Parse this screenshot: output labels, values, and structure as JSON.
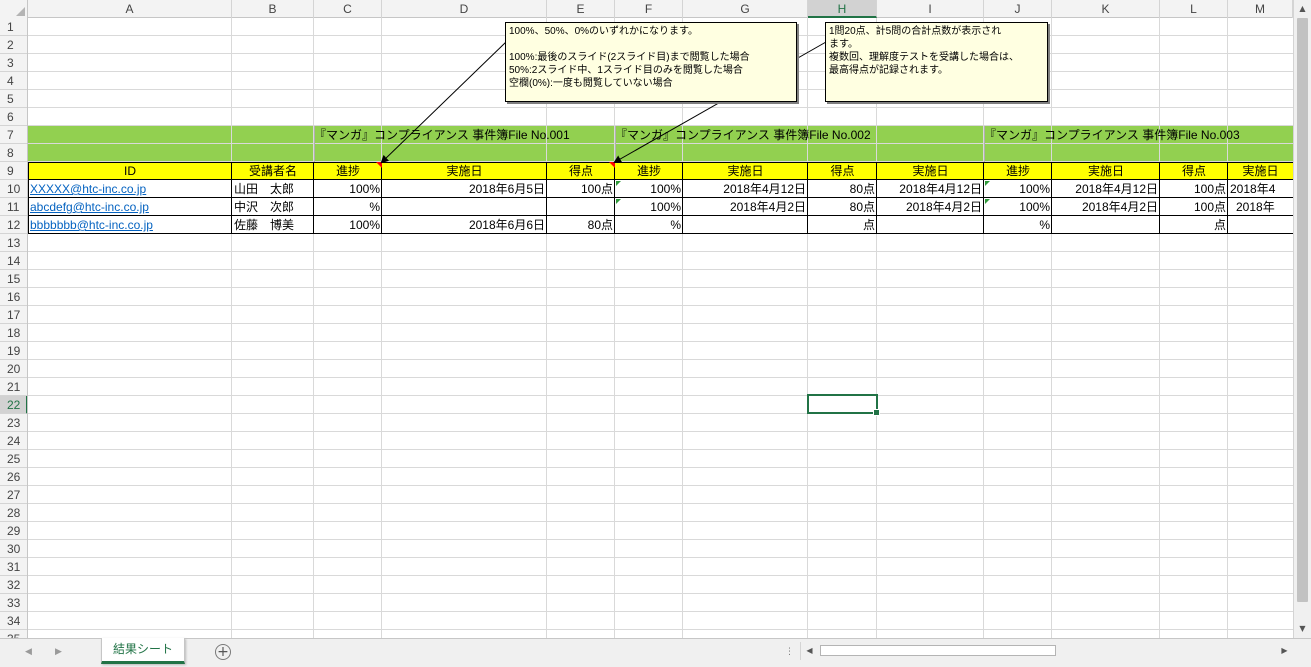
{
  "columns": [
    "A",
    "B",
    "C",
    "D",
    "E",
    "F",
    "G",
    "H",
    "I",
    "J",
    "K",
    "L",
    "M"
  ],
  "selected_column": "H",
  "rows": [
    "1",
    "2",
    "3",
    "4",
    "5",
    "6",
    "7",
    "8",
    "9",
    "10",
    "11",
    "12",
    "13",
    "14",
    "15",
    "16",
    "17",
    "18",
    "19",
    "20",
    "21",
    "22",
    "23",
    "24",
    "25",
    "26",
    "27",
    "28",
    "29",
    "30",
    "31",
    "32",
    "33",
    "34",
    "35"
  ],
  "selected_row": "22",
  "sections": [
    {
      "title": "『マンガ』コンプライアンス 事件簿File No.001"
    },
    {
      "title": "『マンガ』コンプライアンス 事件簿File No.002"
    },
    {
      "title": "『マンガ』コンプライアンス 事件簿File No.003"
    }
  ],
  "headers": {
    "id": "ID",
    "name": "受講者名",
    "progress": "進捗",
    "date": "実施日",
    "score": "得点"
  },
  "records": [
    {
      "id": "XXXXX@htc-inc.co.jp",
      "name": "山田　太郎",
      "s1": {
        "progress": "100%",
        "date": "2018年6月5日",
        "score": "100点"
      },
      "s2": {
        "progress": "100%",
        "date": "2018年4月12日",
        "score": "80点"
      },
      "i_date": "2018年4月12日",
      "s3": {
        "progress": "100%",
        "date": "2018年4月12日",
        "score": "100点",
        "date2": "2018年4"
      }
    },
    {
      "id": "abcdefg@htc-inc.co.jp",
      "name": "中沢　次郎",
      "s1": {
        "progress": "%",
        "date": "",
        "score": ""
      },
      "s2": {
        "progress": "100%",
        "date": "2018年4月2日",
        "score": "80点"
      },
      "i_date": "2018年4月2日",
      "s3": {
        "progress": "100%",
        "date": "2018年4月2日",
        "score": "100点",
        "date2": "2018年"
      }
    },
    {
      "id": "bbbbbbb@htc-inc.co.jp",
      "name": "佐藤　博美",
      "s1": {
        "progress": "100%",
        "date": "2018年6月6日",
        "score": "80点"
      },
      "s2": {
        "progress": "%",
        "date": "",
        "score": "点"
      },
      "i_date": "",
      "s3": {
        "progress": "%",
        "date": "",
        "score": "点",
        "date2": ""
      }
    }
  ],
  "comments": [
    {
      "text": "100%、50%、0%のいずれかになります。\n\n100%:最後のスライド(2スライド目)まで閲覧した場合\n50%:2スライド中、1スライド目のみを閲覧した場合\n空欄(0%):一度も閲覧していない場合"
    },
    {
      "text": "1問20点、計5問の合計点数が表示され\nます。\n複数回、理解度テストを受講した場合は、\n最高得点が記録されます。"
    }
  ],
  "sheet_tab": "結果シート",
  "add_sheet_symbol": "+",
  "icons": {
    "nav_left": "nav-left-icon",
    "nav_right": "nav-right-icon",
    "add_sheet": "add-sheet-icon",
    "split": "split-handle-icon"
  },
  "colors": {
    "header_green": "#92d050",
    "header_yellow": "#ffff00",
    "excel_green": "#217346",
    "link_blue": "#0563c1",
    "comment_bg": "#ffffe1"
  }
}
